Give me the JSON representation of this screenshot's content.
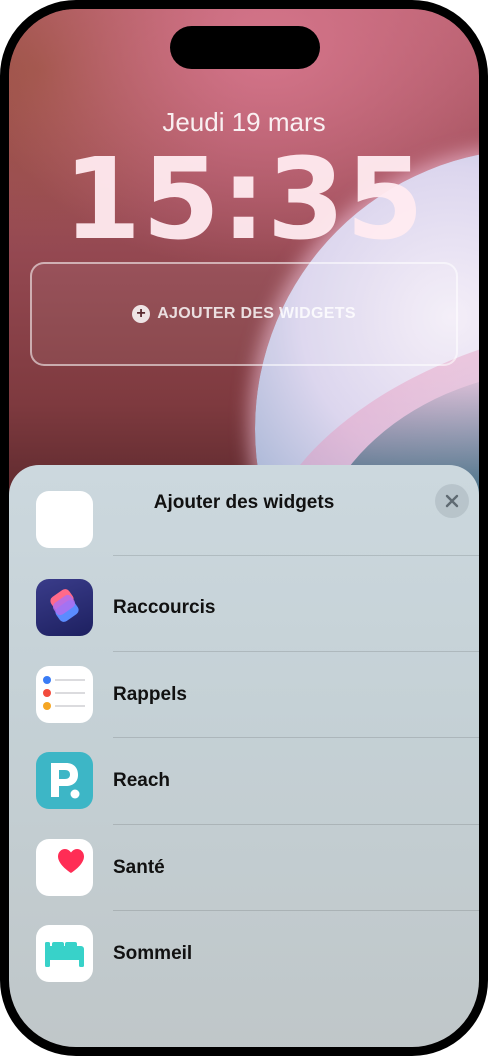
{
  "lockscreen": {
    "date": "Jeudi 19 mars",
    "time": "15:35",
    "add_widgets_label": "AJOUTER DES WIDGETS"
  },
  "sheet": {
    "title": "Ajouter des widgets",
    "close_icon": "close-icon",
    "apps": [
      {
        "label": "Raccourcis",
        "icon": "shortcuts-icon"
      },
      {
        "label": "Rappels",
        "icon": "reminders-icon"
      },
      {
        "label": "Reach",
        "icon": "reach-icon"
      },
      {
        "label": "Santé",
        "icon": "health-icon"
      },
      {
        "label": "Sommeil",
        "icon": "sleep-icon"
      }
    ]
  },
  "colors": {
    "sheet_background": "#c9d5db",
    "reach_teal": "#3db6c6",
    "health_red": "#ff2d55",
    "sleep_teal": "#38d2c9"
  }
}
